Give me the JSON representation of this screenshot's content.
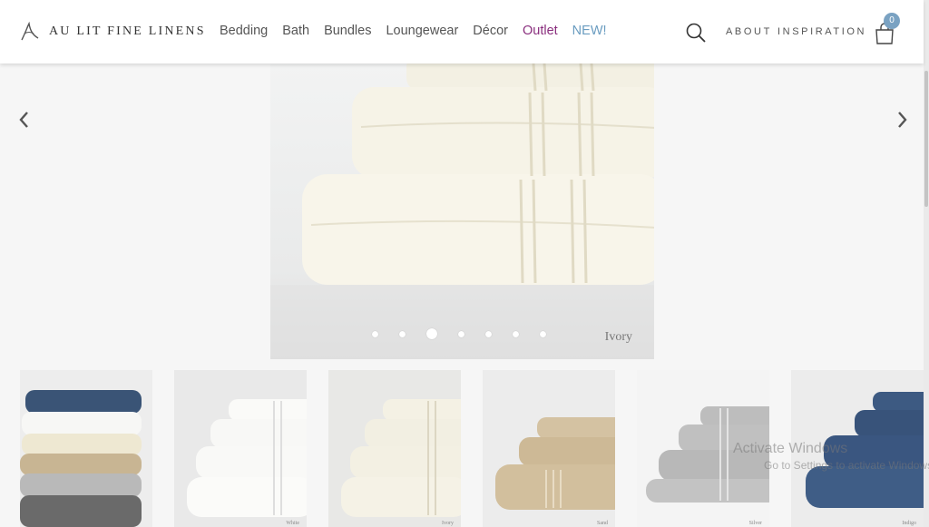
{
  "brand": {
    "name": "AU LIT FINE LINENS"
  },
  "nav": {
    "items": [
      "Bedding",
      "Bath",
      "Bundles",
      "Loungewear",
      "Décor",
      "Outlet",
      "NEW!"
    ]
  },
  "utility": {
    "about": "ABOUT",
    "inspiration": "INSPIRATION"
  },
  "cart": {
    "count": "0"
  },
  "hero": {
    "caption": "Ivory",
    "slides": 7,
    "active_slide": 3
  },
  "thumbnails": [
    {
      "name": "",
      "colors": [
        "#3a5476",
        "#f7f7f5",
        "#eee8d2",
        "#c8b593",
        "#b9b9b9",
        "#6a6a6a"
      ]
    },
    {
      "name": "White",
      "color": "#f8f8f6"
    },
    {
      "name": "Ivory",
      "color": "#f2efe2"
    },
    {
      "name": "Sand",
      "color": "#cdb996"
    },
    {
      "name": "Silver",
      "color": "#bcbcbc"
    },
    {
      "name": "Indigo",
      "color": "#3d5a82"
    }
  ],
  "watermark": {
    "title": "Activate Windows",
    "subtitle": "Go to Settings to activate Windows."
  },
  "colors": {
    "outlet": "#8a2f7e",
    "new": "#6a9cc0",
    "badge": "#7aa2c2"
  }
}
